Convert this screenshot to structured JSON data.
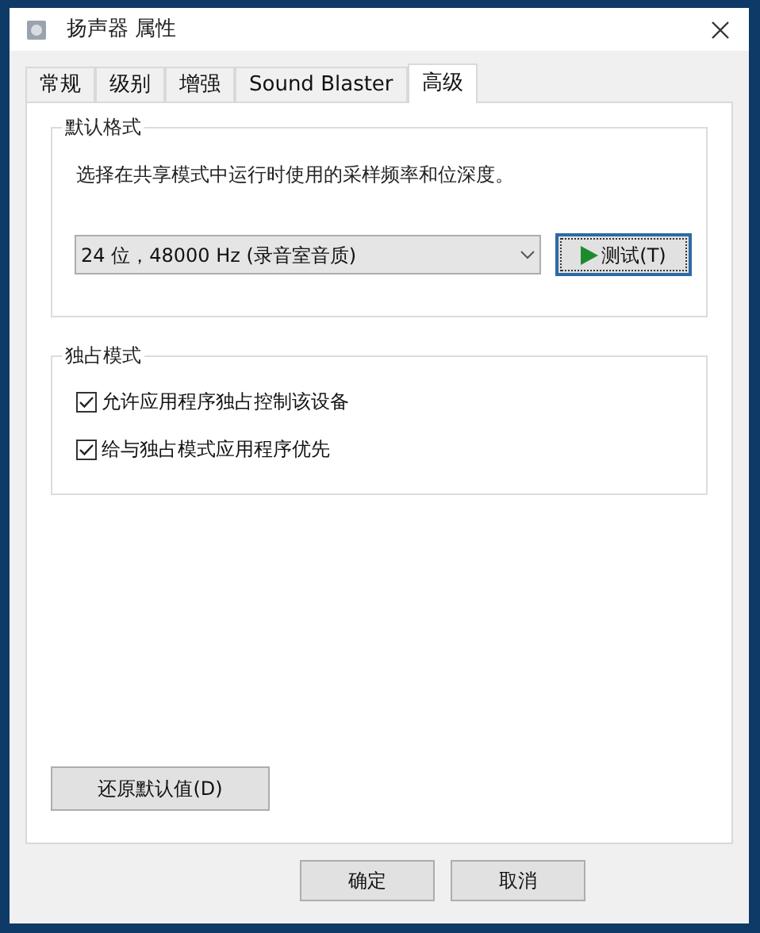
{
  "window": {
    "title": "扬声器 属性"
  },
  "tabs": [
    {
      "label": "常规",
      "selected": false
    },
    {
      "label": "级别",
      "selected": false
    },
    {
      "label": "增强",
      "selected": false
    },
    {
      "label": "Sound Blaster",
      "selected": false
    },
    {
      "label": "高级",
      "selected": true
    }
  ],
  "default_format": {
    "title": "默认格式",
    "description": "选择在共享模式中运行时使用的采样频率和位深度。",
    "format_select": {
      "value": "24 位，48000 Hz (录音室音质)"
    },
    "test_button": "测试(T)"
  },
  "exclusive_mode": {
    "title": "独占模式",
    "options": [
      {
        "label": "允许应用程序独占控制该设备",
        "checked": true
      },
      {
        "label": "给与独占模式应用程序优先",
        "checked": true
      }
    ]
  },
  "restore_button": "还原默认值(D)",
  "buttons": [
    "确定",
    "取消"
  ]
}
